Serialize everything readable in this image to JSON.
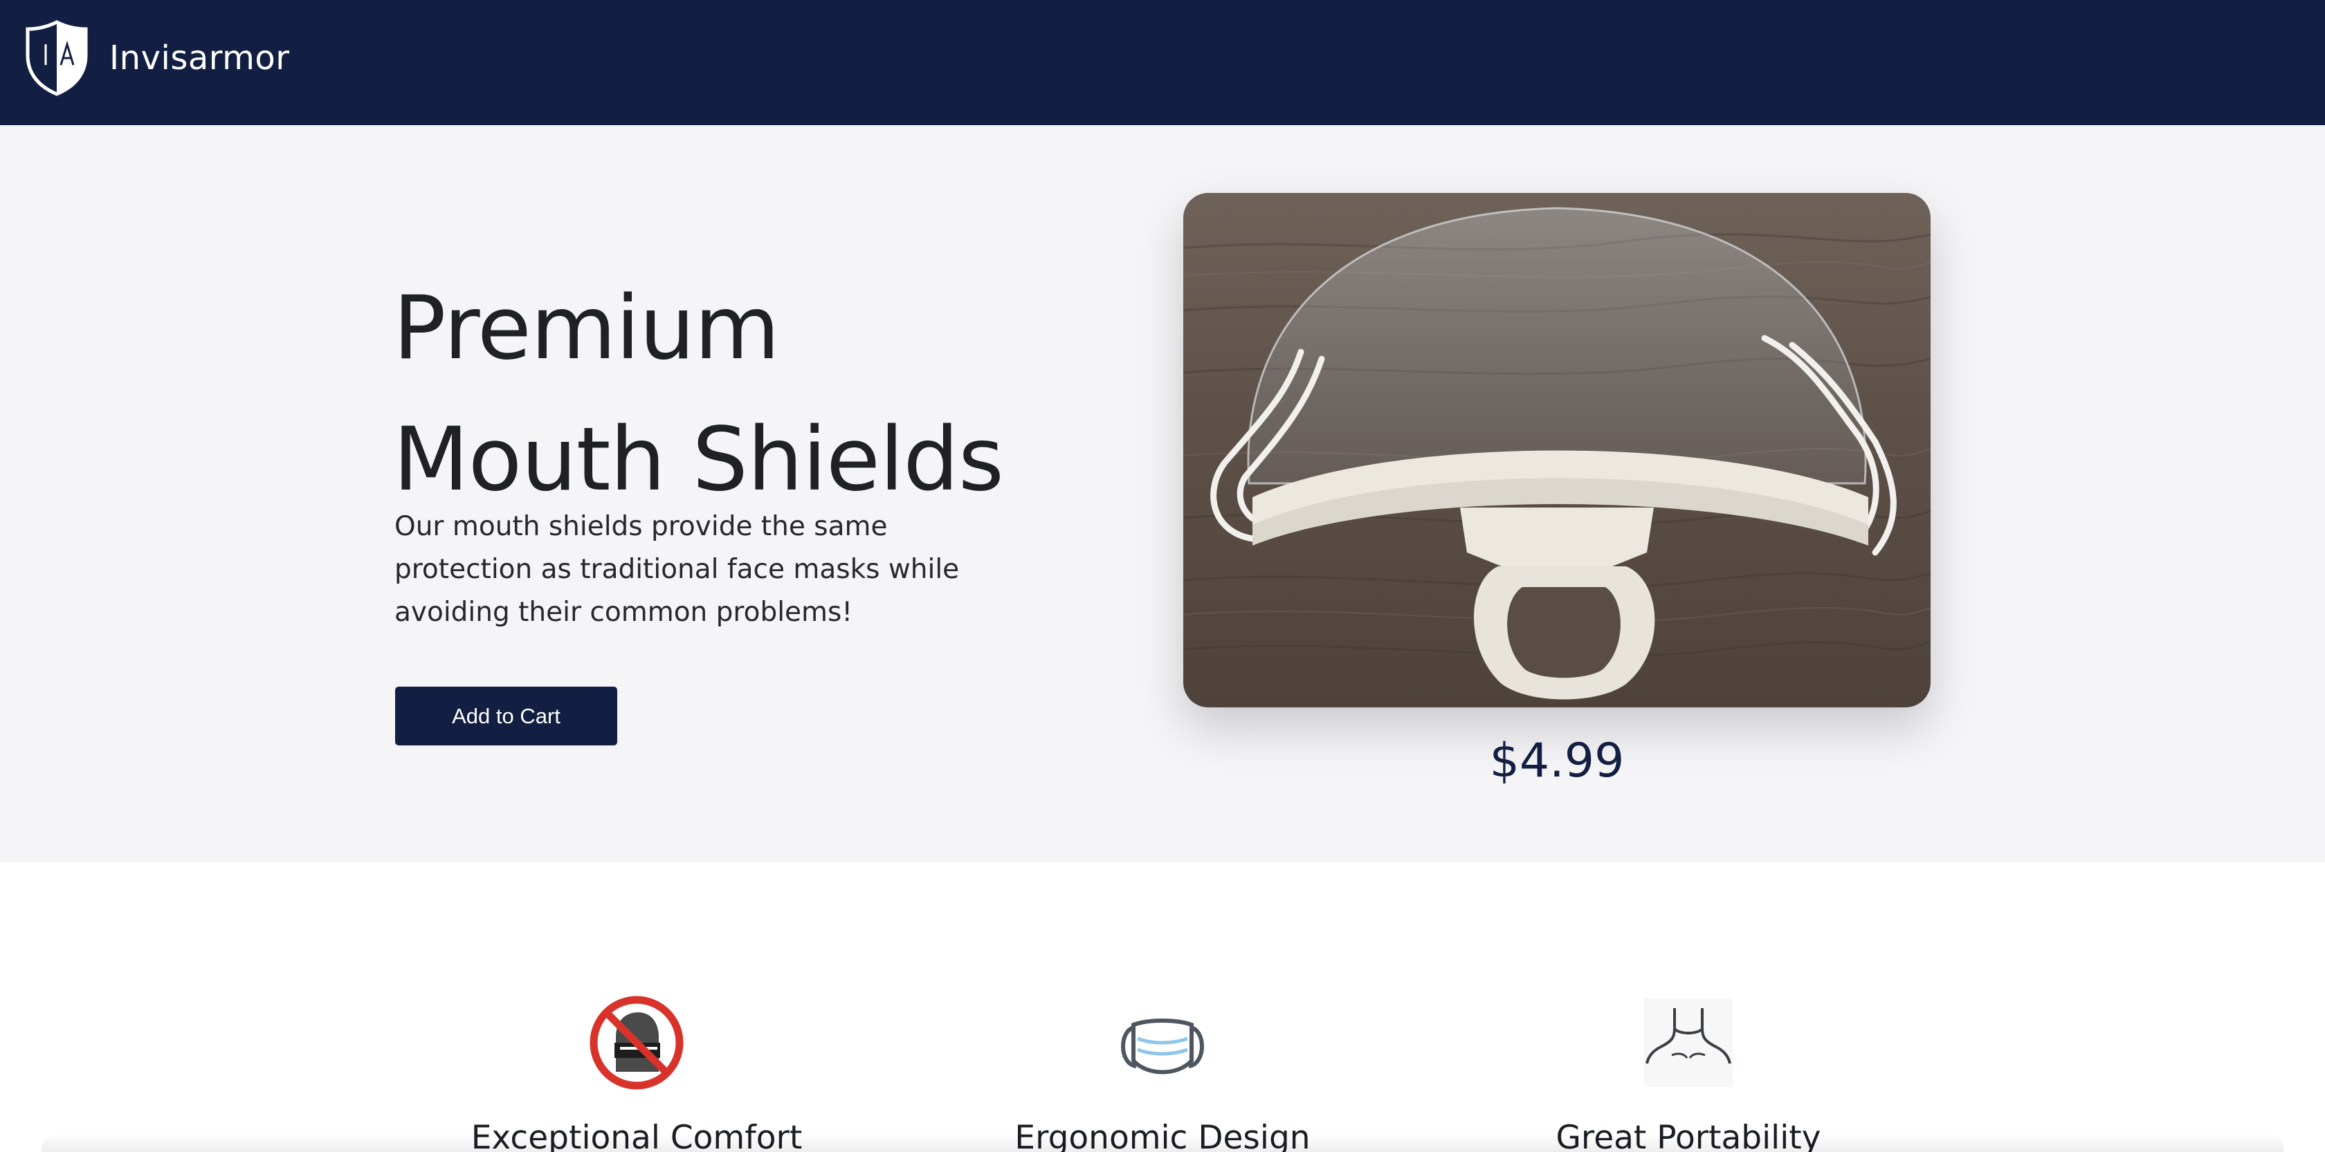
{
  "header": {
    "brand_name": "Invisarmor",
    "logo_letters": "I A",
    "background_color": "#131f42"
  },
  "hero": {
    "title_line1": "Premium",
    "title_line2": "Mouth Shields",
    "description": "Our mouth shields provide the same protection as traditional face masks while avoiding their common problems!",
    "add_to_cart_label": "Add to Cart",
    "price": "$4.99",
    "product_image": "clear-mouth-shield-photo"
  },
  "features": [
    {
      "icon": "no-mask-icon",
      "title": "Exceptional Comfort"
    },
    {
      "icon": "face-mask-icon",
      "title": "Ergonomic Design"
    },
    {
      "icon": "neck-person-icon",
      "title": "Great Portability"
    }
  ],
  "colors": {
    "navy": "#131f42",
    "hero_background": "#f5f5f8",
    "prohibit_red": "#d8322a",
    "mask_blue": "#8ec5ea"
  }
}
